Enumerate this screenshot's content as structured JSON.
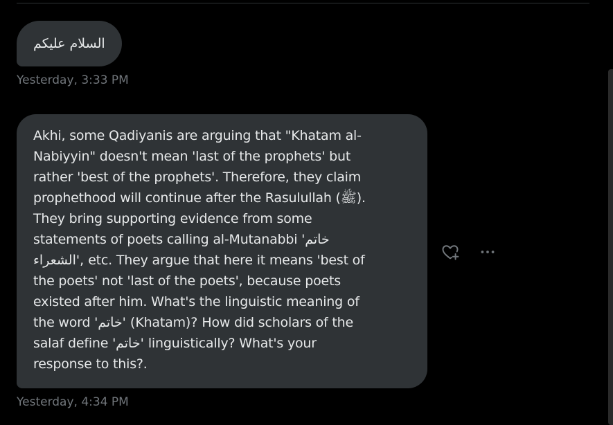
{
  "messages": [
    {
      "text": "السلام عليكم",
      "timestamp": "Yesterday, 3:33 PM"
    },
    {
      "lines": [
        "Akhi, some Qadiyanis are arguing that \"Khatam al-",
        "Nabiyyin\" doesn't mean 'last of the prophets' but",
        "rather 'best of the prophets'. Therefore, they claim",
        "prophethood will continue after the Rasulullah (ﷺ).",
        "They bring supporting evidence from some",
        "statements of poets calling al-Mutanabbi 'خاتم",
        "الشعراء', etc. They argue that here it means 'best of",
        "the poets' not 'last of the poets', because poets",
        "existed after him. What's the linguistic meaning of",
        "the word 'خاتم' (Khatam)? How did scholars of the",
        "salaf define 'خاتم' linguistically? What's your",
        "response to this?."
      ],
      "timestamp": "Yesterday, 4:34 PM"
    }
  ],
  "actions": {
    "react_icon": "heart-plus-icon",
    "more_icon": "more-horizontal-icon"
  },
  "colors": {
    "background": "#000000",
    "bubble": "#2f3336",
    "text": "#e7e9ea",
    "muted": "#71767b"
  }
}
